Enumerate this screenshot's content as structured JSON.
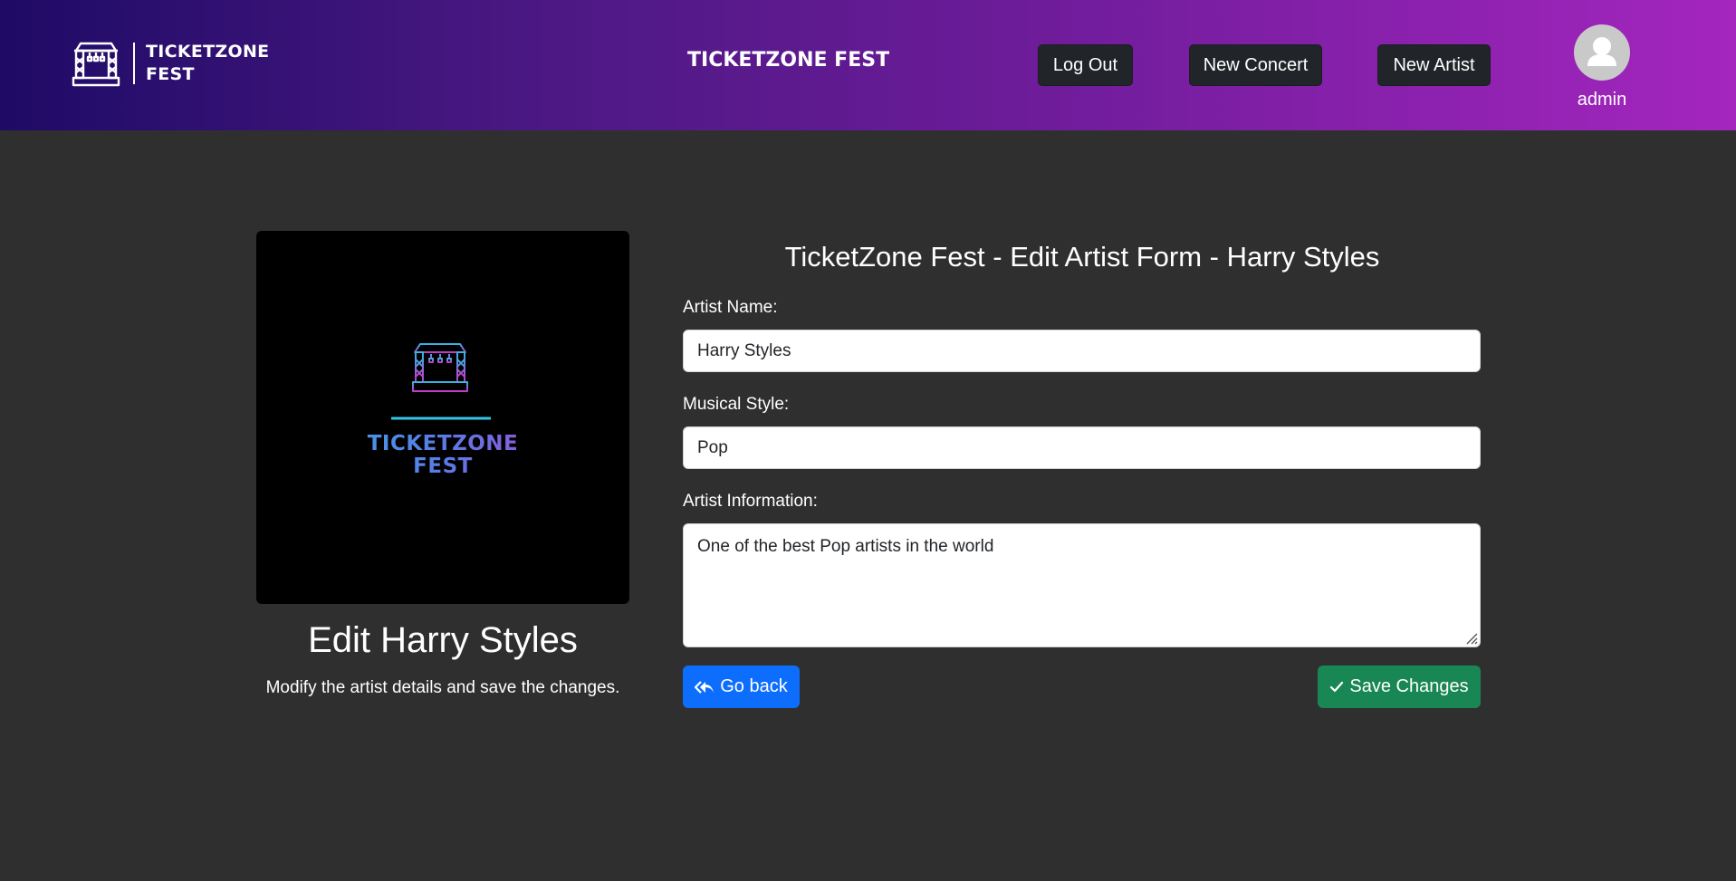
{
  "header": {
    "brand_line1": "TICKETZONE",
    "brand_line2": "FEST",
    "center_title": "TICKETZONE FEST",
    "nav": {
      "logout_label": "Log Out",
      "new_concert_label": "New Concert",
      "new_artist_label": "New Artist"
    },
    "user": {
      "name": "admin",
      "avatar_icon": "user-avatar-icon"
    }
  },
  "left_panel": {
    "logo_line1": "TICKETZONE",
    "logo_line2": "FEST",
    "title": "Edit Harry Styles",
    "subtitle": "Modify the artist details and save the changes."
  },
  "form": {
    "title": "TicketZone Fest - Edit Artist Form - Harry Styles",
    "artist_name_label": "Artist Name:",
    "artist_name_value": "Harry Styles",
    "musical_style_label": "Musical Style:",
    "musical_style_value": "Pop",
    "artist_info_label": "Artist Information:",
    "artist_info_value": "One of the best Pop artists in the world",
    "back_label": "Go back",
    "back_icon": "reply-all-icon",
    "save_label": "Save Changes",
    "save_icon": "check-icon"
  },
  "colors": {
    "header_gradient_start": "#1e0b66",
    "header_gradient_end": "#a426bf",
    "page_background": "#2f2f2f",
    "nav_button": "#212529",
    "back_button": "#0d6efd",
    "save_button": "#198754"
  }
}
